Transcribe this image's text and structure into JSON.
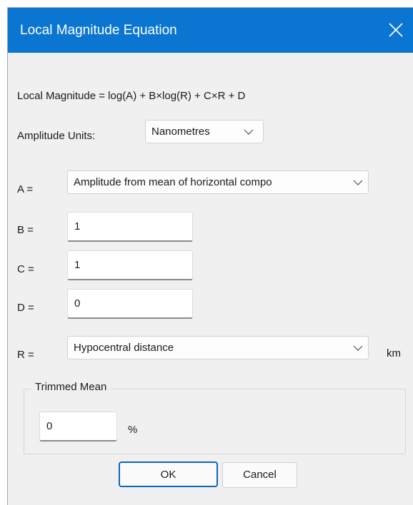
{
  "window": {
    "title": "Local Magnitude Equation"
  },
  "equation": {
    "text": "Local Magnitude = log(A) + B×log(R) + C×R + D"
  },
  "amplitude_units": {
    "label": "Amplitude Units:",
    "value": "Nanometres"
  },
  "a": {
    "label": "A =",
    "value": "Amplitude from mean of horizontal compo"
  },
  "b": {
    "label": "B =",
    "value": "1"
  },
  "c": {
    "label": "C =",
    "value": "1"
  },
  "d": {
    "label": "D =",
    "value": "0"
  },
  "r": {
    "label": "R =",
    "value": "Hypocentral distance",
    "unit": "km"
  },
  "trimmed_mean": {
    "title": "Trimmed Mean",
    "value": "0",
    "unit": "%"
  },
  "buttons": {
    "ok": "OK",
    "cancel": "Cancel"
  },
  "icons": {
    "close": "close-icon",
    "dropdown": "chevron-down-icon"
  },
  "colors": {
    "titlebar": "#0a76d1",
    "ok_border": "#0a67c0",
    "dialog_bg": "#f0f0f0"
  }
}
